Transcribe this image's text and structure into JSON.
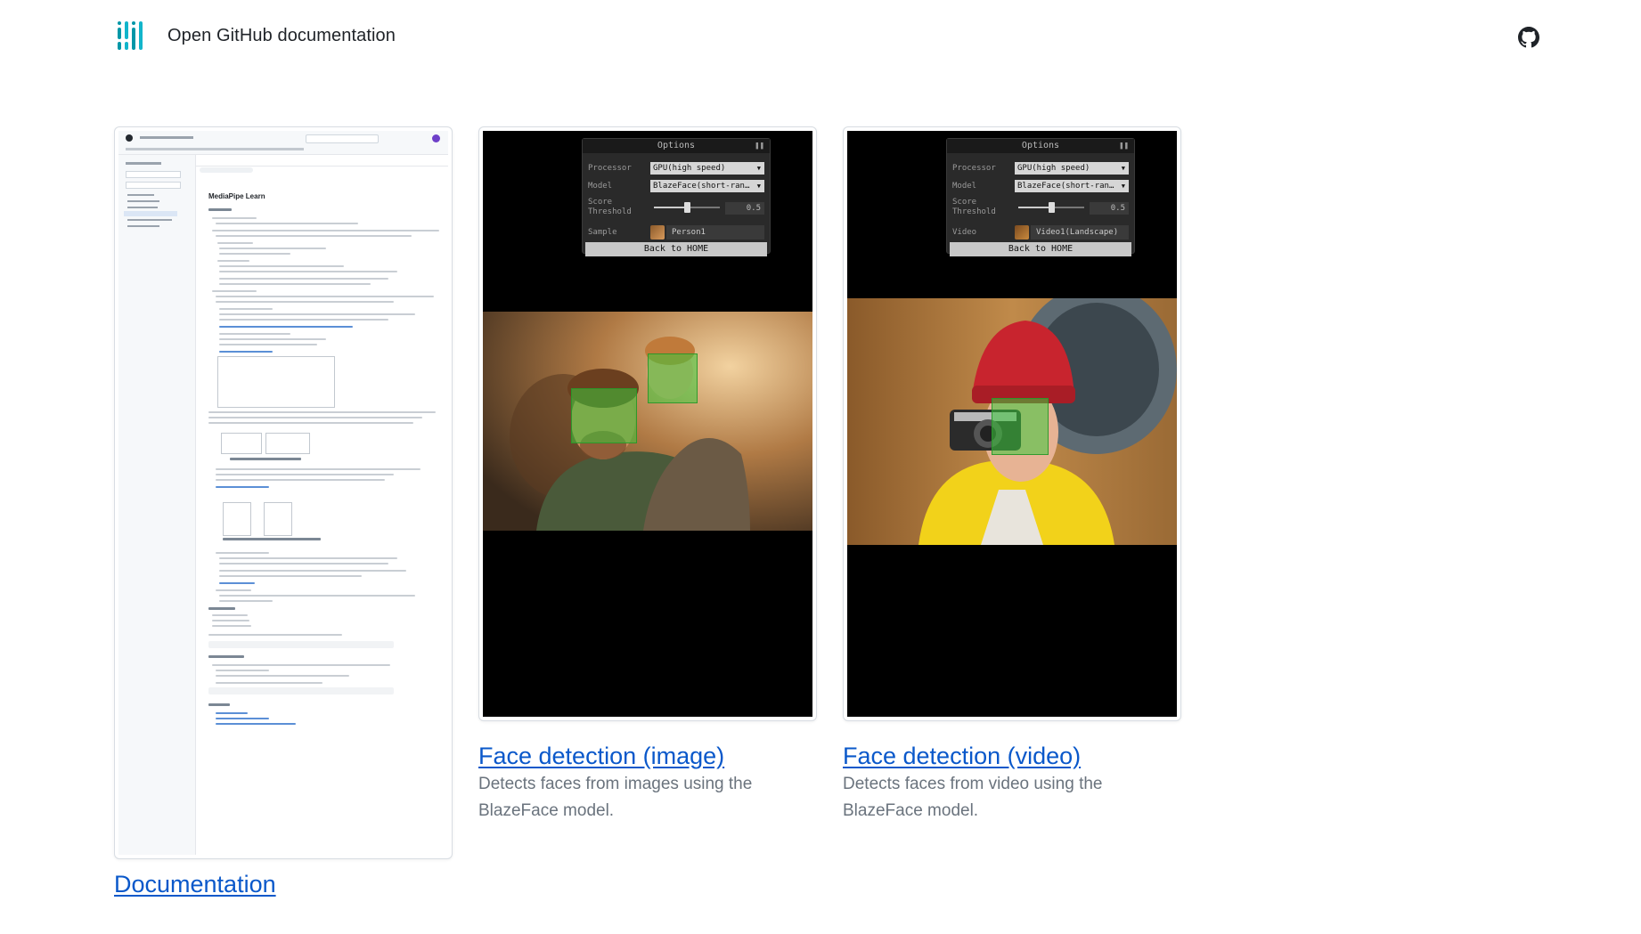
{
  "header": {
    "title": "Open GitHub documentation",
    "logo_icon": "mediapipe-logo-icon",
    "github_icon": "github-icon"
  },
  "cards": {
    "documentation": {
      "link_label": "Documentation",
      "thumbnail": {
        "page_title": "MediaPipe Learn"
      }
    },
    "face_image": {
      "link_label": "Face detection (image)",
      "description": "Detects faces from images using the BlazeFace model.",
      "options": {
        "title": "Options",
        "processor_label": "Processor",
        "processor_value": "GPU(high speed)",
        "model_label": "Model",
        "model_value": "BlazeFace(short-ran…",
        "score_label": "Score Threshold",
        "score_value": "0.5",
        "score_fraction": 0.5,
        "source_label": "Sample",
        "source_value": "Person1",
        "home_button": "Back to HOME"
      }
    },
    "face_video": {
      "link_label": "Face detection (video)",
      "description": "Detects faces from video using the BlazeFace model.",
      "options": {
        "title": "Options",
        "processor_label": "Processor",
        "processor_value": "GPU(high speed)",
        "model_label": "Model",
        "model_value": "BlazeFace(short-ran…",
        "score_label": "Score Threshold",
        "score_value": "0.5",
        "score_fraction": 0.5,
        "source_label": "Video",
        "source_value": "Video1(Landscape)",
        "home_button": "Back to HOME"
      }
    }
  },
  "colors": {
    "link": "#0a58ca",
    "detection_box": "#3cc83c"
  }
}
